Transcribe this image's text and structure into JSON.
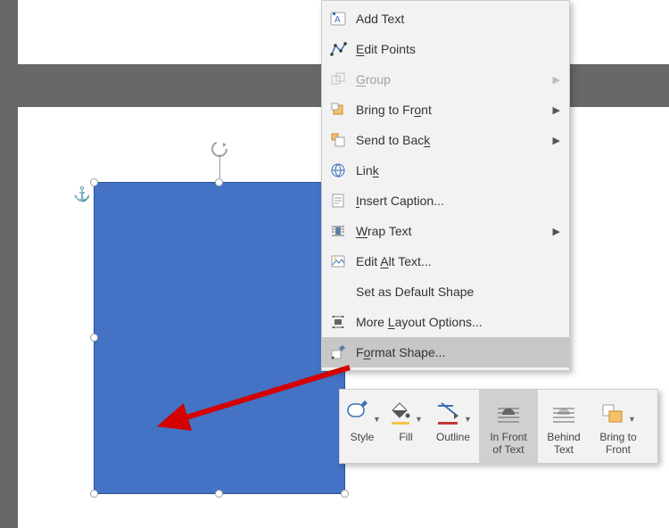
{
  "menu": {
    "addText": "Add Text",
    "editPoints": "dit Points",
    "editPointsMn": "E",
    "group": "roup",
    "groupMn": "G",
    "bringFront": "Bring to Fr",
    "bringFrontMn": "o",
    "bringFront2": "nt",
    "sendBack": "Send to Bac",
    "sendBackMn": "k",
    "link": "Lin",
    "linkMn": "k",
    "insertCaption": "nsert Caption...",
    "insertCaptionMn": "I",
    "wrapText": "rap Text",
    "wrapTextMn": "W",
    "editAlt": "Edit ",
    "editAltMn": "A",
    "editAlt2": "lt Text...",
    "defaultShape": "Set as Default Shape",
    "moreLayout": "More ",
    "moreLayoutMn": "L",
    "moreLayout2": "ayout Options...",
    "formatShape": "F",
    "formatShapeMn": "o",
    "formatShape2": "rmat Shape..."
  },
  "minibar": {
    "style": "Style",
    "fill": "Fill",
    "outline": "Outline",
    "inFront": "In Front\nof Text",
    "behind": "Behind\nText",
    "bringFront": "Bring to\nFront"
  }
}
